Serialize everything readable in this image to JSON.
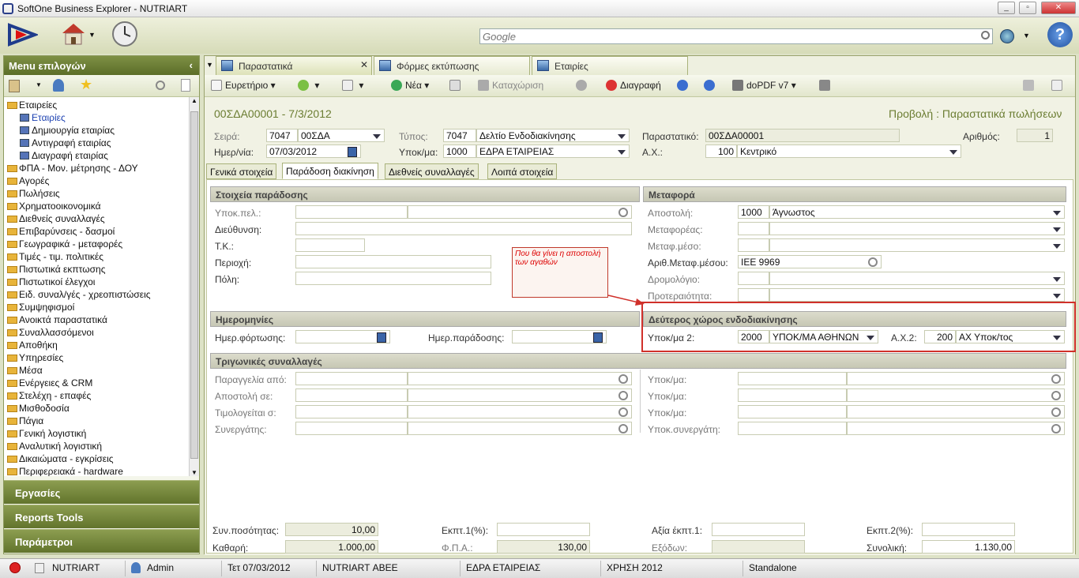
{
  "window": {
    "title": "SoftOne Business Explorer - NUTRIART"
  },
  "search": {
    "placeholder": "Google"
  },
  "left_panel": {
    "header": "Menu επιλογών",
    "tree": [
      {
        "label": "Εταιρείες",
        "level": 0
      },
      {
        "label": "Εταιρίες",
        "level": 1,
        "selected": true
      },
      {
        "label": "Δημιουργία εταιρίας",
        "level": 1
      },
      {
        "label": "Αντιγραφή εταιρίας",
        "level": 1
      },
      {
        "label": "Διαγραφή εταιρίας",
        "level": 1
      },
      {
        "label": "ΦΠΑ - Μον. μέτρησης - ΔΟΥ",
        "level": 0
      },
      {
        "label": "Αγορές",
        "level": 0
      },
      {
        "label": "Πωλήσεις",
        "level": 0
      },
      {
        "label": "Χρηματοοικονομικά",
        "level": 0
      },
      {
        "label": "Διεθνείς συναλλαγές",
        "level": 0
      },
      {
        "label": "Επιβαρύνσεις - δασμοί",
        "level": 0
      },
      {
        "label": "Γεωγραφικά - μεταφορές",
        "level": 0
      },
      {
        "label": "Τιμές - τιμ. πολιτικές",
        "level": 0
      },
      {
        "label": "Πιστωτικά εκπτωσης",
        "level": 0
      },
      {
        "label": "Πιστωτικοί έλεγχοι",
        "level": 0
      },
      {
        "label": "Ειδ. συναλ/γές - χρεοπιστώσεις",
        "level": 0
      },
      {
        "label": "Συμψηφισμοί",
        "level": 0
      },
      {
        "label": "Ανοικτά παραστατικά",
        "level": 0
      },
      {
        "label": "Συναλλασσόμενοι",
        "level": 0
      },
      {
        "label": "Αποθήκη",
        "level": 0
      },
      {
        "label": "Υπηρεσίες",
        "level": 0
      },
      {
        "label": "Μέσα",
        "level": 0
      },
      {
        "label": "Ενέργειες & CRM",
        "level": 0
      },
      {
        "label": "Στελέχη - επαφές",
        "level": 0
      },
      {
        "label": "Μισθοδοσία",
        "level": 0
      },
      {
        "label": "Πάγια",
        "level": 0
      },
      {
        "label": "Γενική λογιστική",
        "level": 0
      },
      {
        "label": "Αναλυτική λογιστική",
        "level": 0
      },
      {
        "label": "Δικαιώματα - εγκρίσεις",
        "level": 0
      },
      {
        "label": "Περιφερειακά - hardware",
        "level": 0
      }
    ],
    "sections": [
      "Εργασίες",
      "Reports Tools",
      "Παράμετροι"
    ]
  },
  "tabs": [
    "Παραστατικά",
    "Φόρμες εκτύπωσης",
    "Εταιρίες"
  ],
  "toolbar": {
    "index": "Ευρετήριο",
    "new": "Νέα",
    "save": "Καταχώριση",
    "delete": "Διαγραφή",
    "printer": "doPDF v7"
  },
  "doc": {
    "title": "00ΣΔΑ00001 - 7/3/2012",
    "view": "Προβολή : Παραστατικά πωλήσεων",
    "series_label": "Σειρά:",
    "series_code": "7047",
    "series_name": "00ΣΔΑ",
    "type_label": "Τύπος:",
    "type_code": "7047",
    "type_name": "Δελτίο Ενδοδιακίνησης",
    "doc_label": "Παραστατικό:",
    "doc_value": "00ΣΔΑ00001",
    "number_label": "Αριθμός:",
    "number_value": "1",
    "date_label": "Ημερ/νία:",
    "date_value": "07/03/2012",
    "branch_label": "Υποκ/μα:",
    "branch_code": "1000",
    "branch_name": "ΕΔΡΑ ΕΤΑΙΡΕΙΑΣ",
    "wh_label": "Α.Χ.:",
    "wh_code": "100",
    "wh_name": "Κεντρικό"
  },
  "subtabs": [
    "Γενικά στοιχεία",
    "Παράδοση διακίνηση",
    "Διεθνείς συναλλαγές",
    "Λοιπά στοιχεία"
  ],
  "delivery": {
    "header": "Στοιχεία παράδοσης",
    "customer_branch": "Υποκ.πελ.:",
    "address": "Διεύθυνση:",
    "zip": "Τ.Κ.:",
    "area": "Περιοχή:",
    "city": "Πόλη:"
  },
  "transport": {
    "header": "Μεταφορά",
    "shipment_label": "Αποστολή:",
    "shipment_code": "1000",
    "shipment_name": "Άγνωστος",
    "carrier_label": "Μεταφορέας:",
    "means_label": "Μεταφ.μέσο:",
    "plate_label": "Αριθ.Μεταφ.μέσου:",
    "plate_value": "ΙΕΕ 9969",
    "route_label": "Δρομολόγιο:",
    "priority_label": "Προτεραιότητα:"
  },
  "annotation": "Που θα γίνει η αποστολή των αγαθών",
  "dates": {
    "header": "Ημερομηνίες",
    "load": "Ημερ.φόρτωσης:",
    "delivery": "Ημερ.παράδοσης:"
  },
  "second": {
    "header": "Δεύτερος χώρος ενδοδιακίνησης",
    "branch_label": "Υποκ/μα 2:",
    "branch_code": "2000",
    "branch_name": "ΥΠΟΚ/ΜΑ ΑΘΗΝΩΝ",
    "wh_label": "Α.Χ.2:",
    "wh_code": "200",
    "wh_name": "ΑΧ Υποκ/τος"
  },
  "triangular": {
    "header": "Τριγωνικές συναλλαγές",
    "left": [
      "Παραγγελία από:",
      "Αποστολή σε:",
      "Τιμολογείται σ:",
      "Συνεργάτης:"
    ],
    "right": [
      "Υποκ/μα:",
      "Υποκ/μα:",
      "Υποκ/μα:",
      "Υποκ.συνεργάτη:"
    ]
  },
  "totals": {
    "qty_label": "Συν.ποσότητας:",
    "qty_value": "10,00",
    "net_label": "Καθαρή:",
    "net_value": "1.000,00",
    "disc1_label": "Εκπτ.1(%):",
    "vat_label": "Φ.Π.Α.:",
    "vat_value": "130,00",
    "disc_value_label": "Αξία έκπτ.1:",
    "expenses_label": "Εξόδων:",
    "disc2_label": "Εκπτ.2(%):",
    "total_label": "Συνολική:",
    "total_value": "1.130,00"
  },
  "status": {
    "company": "NUTRIART",
    "user": "Admin",
    "date": "Τετ 07/03/2012",
    "company_name": "NUTRIART ΑΒΕΕ",
    "branch": "ΕΔΡΑ ΕΤΑΙΡΕΙΑΣ",
    "year": "ΧΡΗΣΗ 2012",
    "mode": "Standalone"
  },
  "colors": {
    "accent": "#6b7d32",
    "annotation": "#d0302a"
  }
}
